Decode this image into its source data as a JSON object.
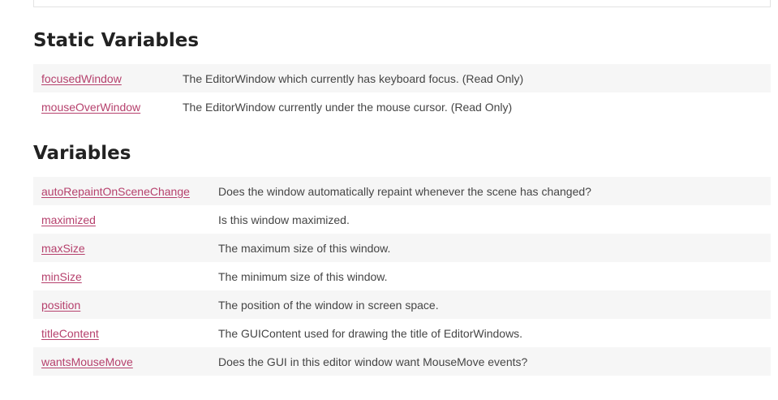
{
  "static_variables": {
    "title": "Static Variables",
    "rows": [
      {
        "name": "focusedWindow",
        "desc": "The EditorWindow which currently has keyboard focus. (Read Only)"
      },
      {
        "name": "mouseOverWindow",
        "desc": "The EditorWindow currently under the mouse cursor. (Read Only)"
      }
    ]
  },
  "variables": {
    "title": "Variables",
    "rows": [
      {
        "name": "autoRepaintOnSceneChange",
        "desc": "Does the window automatically repaint whenever the scene has changed?"
      },
      {
        "name": "maximized",
        "desc": "Is this window maximized."
      },
      {
        "name": "maxSize",
        "desc": "The maximum size of this window."
      },
      {
        "name": "minSize",
        "desc": "The minimum size of this window."
      },
      {
        "name": "position",
        "desc": "The position of the window in screen space."
      },
      {
        "name": "titleContent",
        "desc": "The GUIContent used for drawing the title of EditorWindows."
      },
      {
        "name": "wantsMouseMove",
        "desc": "Does the GUI in this editor window want MouseMove events?"
      }
    ]
  },
  "colors": {
    "link": "#b6416d",
    "row_alt": "#f6f6f6",
    "heading": "#222222"
  }
}
